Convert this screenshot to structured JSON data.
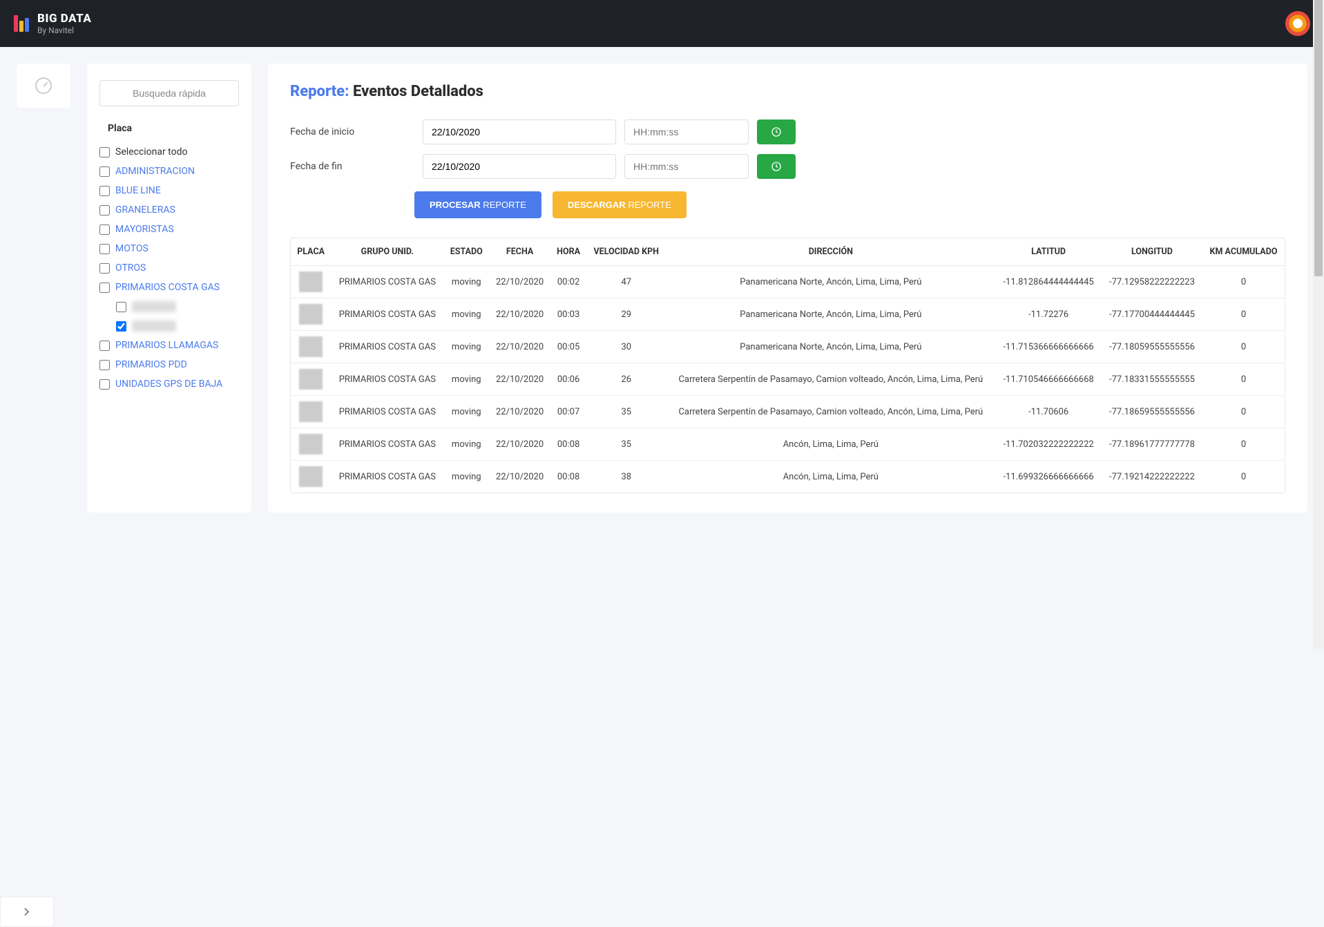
{
  "header": {
    "title": "BIG DATA",
    "subtitle": "By Navitel"
  },
  "sidebar": {
    "search_placeholder": "Busqueda rápida",
    "section_label": "Placa",
    "items": [
      {
        "label": "Seleccionar todo",
        "checked": false,
        "link": false
      },
      {
        "label": "ADMINISTRACION",
        "checked": false,
        "link": true
      },
      {
        "label": "BLUE LINE",
        "checked": false,
        "link": true
      },
      {
        "label": "GRANELERAS",
        "checked": false,
        "link": true
      },
      {
        "label": "MAYORISTAS",
        "checked": false,
        "link": true
      },
      {
        "label": "MOTOS",
        "checked": false,
        "link": true
      },
      {
        "label": "OTROS",
        "checked": false,
        "link": true
      },
      {
        "label": "PRIMARIOS COSTA GAS",
        "checked": false,
        "link": true
      },
      {
        "label": "PRIMARIOS LLAMAGAS",
        "checked": false,
        "link": true
      },
      {
        "label": "PRIMARIOS PDD",
        "checked": false,
        "link": true
      },
      {
        "label": "UNIDADES GPS DE BAJA",
        "checked": false,
        "link": true
      }
    ],
    "sub_items": [
      {
        "label": "XXX-XXX",
        "checked": false
      },
      {
        "label": "XXX-XXX",
        "checked": true
      }
    ]
  },
  "report": {
    "title_prefix": "Reporte:",
    "title_main": "Eventos Detallados",
    "start_label": "Fecha de inicio",
    "end_label": "Fecha de fin",
    "start_date": "22/10/2020",
    "end_date": "22/10/2020",
    "time_placeholder": "HH:mm:ss",
    "process_strong": "PROCESAR",
    "process_rest": " REPORTE",
    "download_strong": "DESCARGAR",
    "download_rest": " REPORTE"
  },
  "table": {
    "headers": [
      "PLACA",
      "GRUPO UNID.",
      "ESTADO",
      "FECHA",
      "HORA",
      "VELOCIDAD KPH",
      "DIRECCIÓN",
      "LATITUD",
      "LONGITUD",
      "KM ACUMULADO"
    ],
    "rows": [
      {
        "grupo": "PRIMARIOS COSTA GAS",
        "estado": "moving",
        "fecha": "22/10/2020",
        "hora": "00:02",
        "vel": "47",
        "dir": "Panamericana Norte, Ancón, Lima, Lima, Perú",
        "lat": "-11.812864444444445",
        "lon": "-77.12958222222223",
        "km": "0"
      },
      {
        "grupo": "PRIMARIOS COSTA GAS",
        "estado": "moving",
        "fecha": "22/10/2020",
        "hora": "00:03",
        "vel": "29",
        "dir": "Panamericana Norte, Ancón, Lima, Lima, Perú",
        "lat": "-11.72276",
        "lon": "-77.17700444444445",
        "km": "0"
      },
      {
        "grupo": "PRIMARIOS COSTA GAS",
        "estado": "moving",
        "fecha": "22/10/2020",
        "hora": "00:05",
        "vel": "30",
        "dir": "Panamericana Norte, Ancón, Lima, Lima, Perú",
        "lat": "-11.715366666666666",
        "lon": "-77.18059555555556",
        "km": "0"
      },
      {
        "grupo": "PRIMARIOS COSTA GAS",
        "estado": "moving",
        "fecha": "22/10/2020",
        "hora": "00:06",
        "vel": "26",
        "dir": "Carretera Serpentín de Pasamayo, Camion volteado, Ancón, Lima, Lima, Perú",
        "lat": "-11.710546666666668",
        "lon": "-77.18331555555555",
        "km": "0"
      },
      {
        "grupo": "PRIMARIOS COSTA GAS",
        "estado": "moving",
        "fecha": "22/10/2020",
        "hora": "00:07",
        "vel": "35",
        "dir": "Carretera Serpentín de Pasamayo, Camion volteado, Ancón, Lima, Lima, Perú",
        "lat": "-11.70606",
        "lon": "-77.18659555555556",
        "km": "0"
      },
      {
        "grupo": "PRIMARIOS COSTA GAS",
        "estado": "moving",
        "fecha": "22/10/2020",
        "hora": "00:08",
        "vel": "35",
        "dir": "Ancón, Lima, Lima, Perú",
        "lat": "-11.702032222222222",
        "lon": "-77.18961777777778",
        "km": "0"
      },
      {
        "grupo": "PRIMARIOS COSTA GAS",
        "estado": "moving",
        "fecha": "22/10/2020",
        "hora": "00:08",
        "vel": "38",
        "dir": "Ancón, Lima, Lima, Perú",
        "lat": "-11.699326666666666",
        "lon": "-77.19214222222222",
        "km": "0"
      }
    ]
  }
}
